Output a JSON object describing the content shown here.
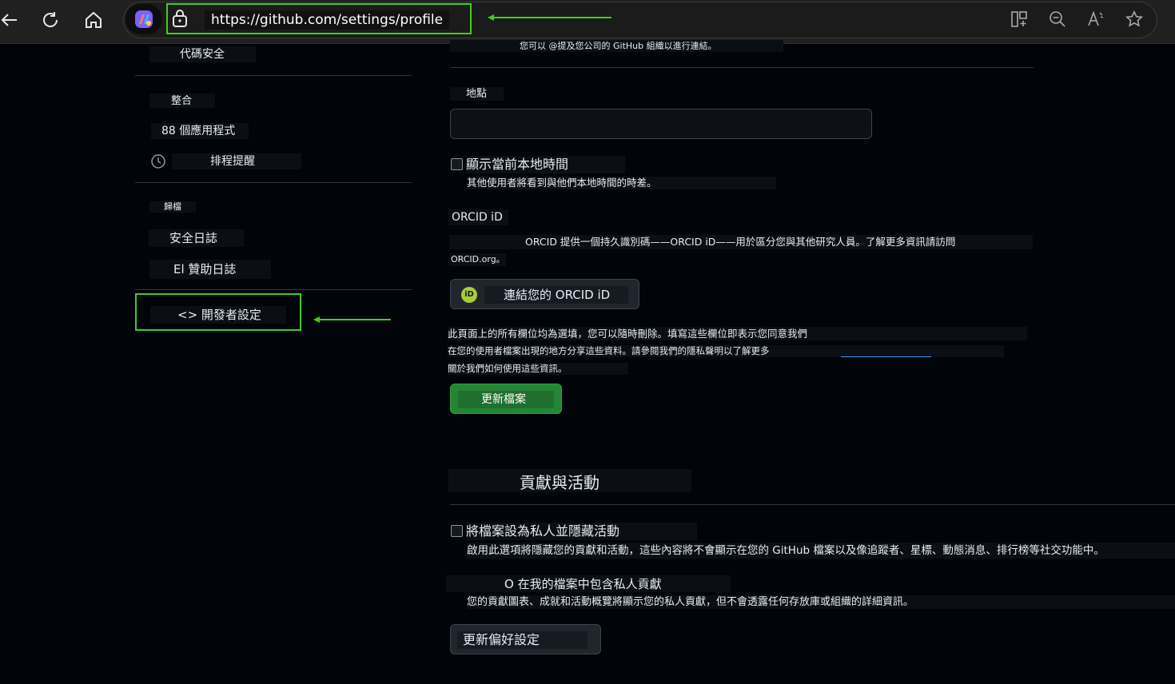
{
  "browser": {
    "url": "https://github.com/settings/profile",
    "icons": {
      "back": "back-arrow-icon",
      "refresh": "refresh-icon",
      "home": "home-icon",
      "copilot": "copilot-icon",
      "lock": "lock-icon",
      "split": "split-screen-icon",
      "zoom": "zoom-out-icon",
      "read": "read-aloud-icon",
      "favorite": "star-icon"
    },
    "highlight_color": "#3fce1f"
  },
  "sidebar": {
    "code_security": "代碼安全",
    "integrations_heading": "整合",
    "apps": "88 個應用程式",
    "scheduled_reminders": "排程提醒",
    "archives_heading": "歸檔",
    "security_log": "安全日誌",
    "sponsorship_log": "El 贊助日誌",
    "developer_settings": "<> 開發者設定"
  },
  "profile": {
    "company_hint": "您可以 @提及您公司的 GitHub 組織以進行連結。",
    "location_label": "地點",
    "location_value": "",
    "show_local_time_label": "顯示當前本地時間",
    "show_local_time_hint": "其他使用者將看到與他們本地時間的時差。",
    "orcid_heading": "ORCID iD",
    "orcid_desc_1": "ORCID 提供一個持久識別碼——ORCID iD——用於區分您與其他研究人員。了解更多資訊請訪問",
    "orcid_desc_2": "ORCID.org。",
    "connect_orcid": "連結您的 ORCID iD",
    "orcid_badge": "iD",
    "optional_notice_1": "此頁面上的所有欄位均為選填，您可以隨時刪除。填寫這些欄位即表示您同意我們",
    "optional_notice_2": "在您的使用者檔案出現的地方分享這些資料。請參閱我們的隱私聲明以了解更多",
    "optional_notice_3": "關於我們如何使用這些資訊。",
    "update_profile": "更新檔案"
  },
  "contributions": {
    "heading": "貢獻與活動",
    "private_label": "將檔案設為私人並隱藏活動",
    "private_hint": "啟用此選項將隱藏您的貢獻和活動，這些內容將不會顯示在您的 GitHub 檔案以及像追蹤者、星標、動態消息、排行榜等社交功能中。",
    "include_private_label": "O 在我的檔案中包含私人貢獻",
    "include_private_hint": "您的貢獻圖表、成就和活動概覽將顯示您的私人貢獻，但不會透露任何存放庫或組織的詳細資訊。",
    "update_preferences": "更新偏好設定"
  }
}
